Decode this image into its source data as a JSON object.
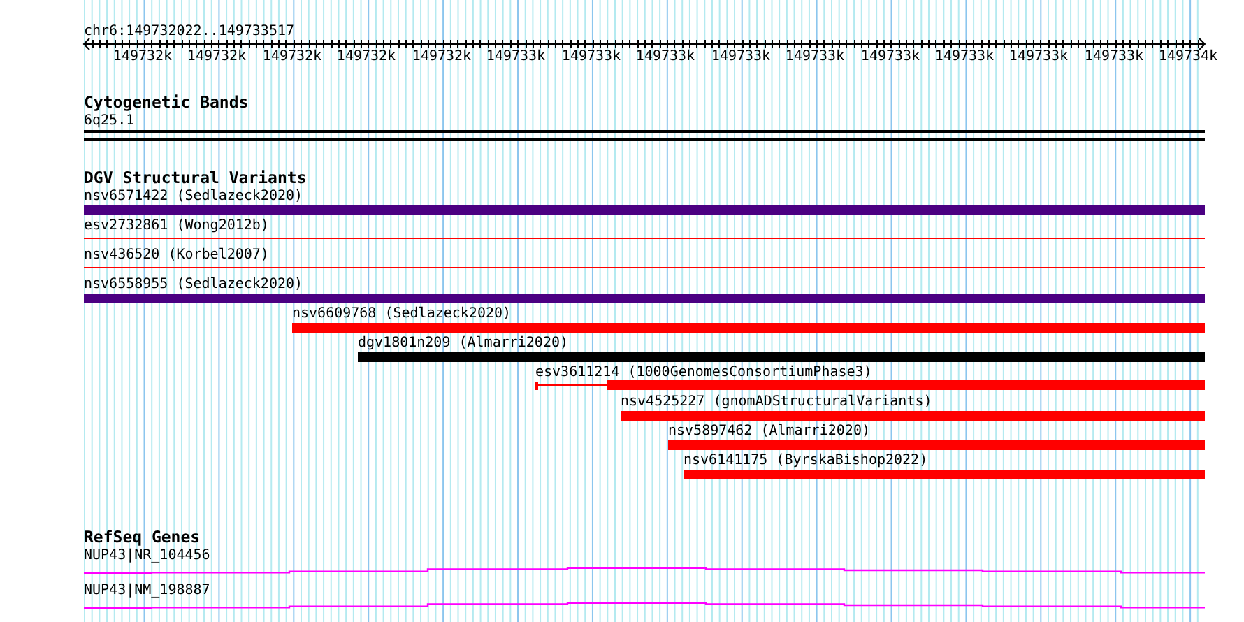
{
  "ruler": {
    "region": "chr6:149732022..149733517",
    "tick_labels": [
      "149732k",
      "149732k",
      "149732k",
      "149732k",
      "149732k",
      "149733k",
      "149733k",
      "149733k",
      "149733k",
      "149733k",
      "149733k",
      "149733k",
      "149733k",
      "149733k",
      "149734k"
    ]
  },
  "cytogenetic_bands": {
    "title": "Cytogenetic Bands",
    "band": "6q25.1"
  },
  "dgv_structural_variants": {
    "title": "DGV Structural Variants",
    "features": [
      {
        "label": "nsv6571422 (Sedlazeck2020)",
        "kind": "thick",
        "color": "#4b0082"
      },
      {
        "label": "esv2732861 (Wong2012b)",
        "kind": "line",
        "color": "#ff0000"
      },
      {
        "label": "nsv436520 (Korbel2007)",
        "kind": "line",
        "color": "#ff0000"
      },
      {
        "label": "nsv6558955 (Sedlazeck2020)",
        "kind": "thick",
        "color": "#4b0082"
      },
      {
        "label": "nsv6609768 (Sedlazeck2020)",
        "kind": "thick",
        "color": "#ff0000"
      },
      {
        "label": "dgv1801n209 (Almarri2020)",
        "kind": "thick",
        "color": "#000000"
      },
      {
        "label": "esv3611214 (1000GenomesConsortiumPhase3)",
        "kind": "split",
        "color": "#ff0000"
      },
      {
        "label": "nsv4525227 (gnomADStructuralVariants)",
        "kind": "thick",
        "color": "#ff0000"
      },
      {
        "label": "nsv5897462 (Almarri2020)",
        "kind": "thick",
        "color": "#ff0000"
      },
      {
        "label": "nsv6141175 (ByrskaBishop2022)",
        "kind": "thick",
        "color": "#ff0000"
      }
    ]
  },
  "refseq_genes": {
    "title": "RefSeq Genes",
    "transcripts": [
      {
        "label": "NUP43|NR_104456"
      },
      {
        "label": "NUP43|NM_198887"
      }
    ]
  }
}
